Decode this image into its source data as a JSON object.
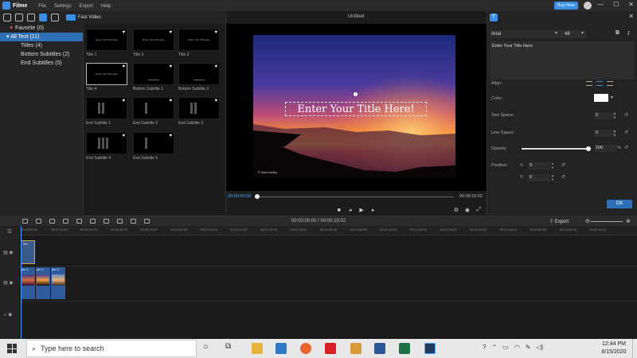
{
  "app": {
    "name": "Filme",
    "menu": [
      "File",
      "Settings",
      "Export",
      "Help"
    ],
    "buy_now": "Buy Now"
  },
  "toolbar": {
    "fast_video": "Fast Video"
  },
  "nav": {
    "favorite": "Favorite (0)",
    "all_text": "All Text (11)",
    "titles": "Titles (4)",
    "bottom_subtitles": "Bottom Subtitles (2)",
    "end_subtitles": "End Subtitles (5)"
  },
  "library": {
    "items": [
      {
        "label": "Title 1",
        "preview": "Enter Your Title Here"
      },
      {
        "label": "Title 2",
        "preview": "Enter Your Title Here"
      },
      {
        "label": "Title 3",
        "preview": "Enter Your Title Here"
      },
      {
        "label": "Title 4",
        "preview": "Enter Your Title Here"
      },
      {
        "label": "Bottom Subtitle 1",
        "preview": ""
      },
      {
        "label": "Bottom Subtitle 2",
        "preview": ""
      },
      {
        "label": "End Subtitle 1",
        "preview": ""
      },
      {
        "label": "End Subtitle 2",
        "preview": ""
      },
      {
        "label": "End Subtitle 3",
        "preview": ""
      },
      {
        "label": "End Subtitle 4",
        "preview": ""
      },
      {
        "label": "End Subtitle 5",
        "preview": ""
      }
    ]
  },
  "preview": {
    "title": "Untitled",
    "overlay_text": "Enter Your Title Here!",
    "watermark": "© Nick Kelley",
    "time_current": "00:00:00:00",
    "time_end": "00:00:15:02"
  },
  "props": {
    "font": "Arial",
    "size": "48",
    "bold": "B",
    "italic": "I",
    "text": "Enter Your Title Here",
    "align_label": "Align:",
    "color_label": "Color:",
    "text_space_label": "Text Space:",
    "text_space": "0",
    "line_space_label": "Line Space:",
    "line_space": "0",
    "opacity_label": "Opacity:",
    "opacity": "100",
    "opacity_unit": "%",
    "opacity_level": 1.0,
    "position_label": "Position:",
    "x_label": "X:",
    "x": "0",
    "y_label": "Y:",
    "y": "0",
    "ok": "OK",
    "color_value": "#ffffff"
  },
  "timeline": {
    "time": "00:00:00:00 / 00:00:15:02",
    "export": "Export",
    "ruler": [
      "00:00:00:00",
      "00:00:10:00",
      "00:00:20:00",
      "00:00:30:00",
      "00:00:40:00",
      "00:00:50:00",
      "00:01:00:00",
      "00:01:10:00",
      "00:01:20:00",
      "00:01:30:00",
      "00:01:40:00",
      "00:01:50:00",
      "00:02:00:00",
      "00:02:10:00",
      "00:02:20:00",
      "00:02:30:00",
      "00:02:40:00",
      "00:02:50:00",
      "00:03:00:00",
      "00:03:10:00"
    ],
    "title_clip": "Title",
    "video_clips": [
      "pic 1",
      "pic 2",
      "pic 3"
    ]
  },
  "taskbar": {
    "search_placeholder": "Type here to search",
    "time": "12:44 PM",
    "date": "8/15/2020"
  }
}
